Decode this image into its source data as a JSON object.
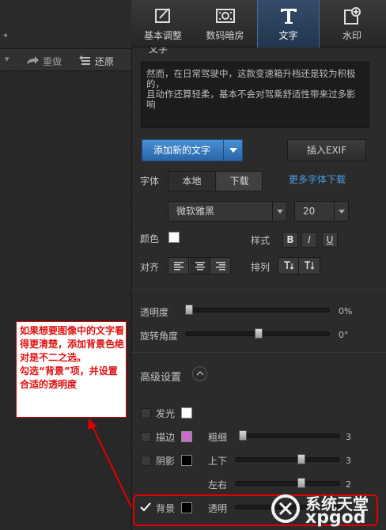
{
  "tabs": [
    {
      "label": "基本调整",
      "icon": "crop-icon"
    },
    {
      "label": "数码暗房",
      "icon": "film-icon"
    },
    {
      "label": "文字",
      "icon": "text-icon"
    },
    {
      "label": "水印",
      "icon": "watermark-icon"
    }
  ],
  "toolbar": {
    "redo": "重做",
    "restore": "还原"
  },
  "section_title": "文字",
  "text_content": "然而，在日常驾驶中，这款变速箱升档还是较为积极的，\n且动作还算轻柔，基本不会对驾乘舒适性带来过多影响",
  "add_text_button": "添加新的文字",
  "insert_exif_button": "插入EXIF",
  "font": {
    "label": "字体",
    "tab_local": "本地",
    "tab_download": "下载",
    "more_link": "更多字体下载",
    "family": "微软雅黑",
    "size": "20"
  },
  "color_label": "颜色",
  "style_label": "样式",
  "style_buttons": [
    "B",
    "I",
    "U"
  ],
  "align_label": "对齐",
  "arrange_label": "排列",
  "opacity": {
    "label": "透明度",
    "value": 0,
    "value_text": "0%"
  },
  "rotation": {
    "label": "旋转角度",
    "value": 0,
    "value_text": "0°"
  },
  "advanced_label": "高级设置",
  "glow": {
    "label": "发光",
    "checked": false,
    "color": "#ffffff"
  },
  "stroke": {
    "label": "描边",
    "checked": false,
    "color": "#c76fc7",
    "thickness_label": "粗细",
    "thickness_value": "3"
  },
  "shadow": {
    "label": "阴影",
    "checked": false,
    "color": "#000000",
    "vertical_label": "上下",
    "vertical_value": "3",
    "horizontal_label": "左右",
    "horizontal_value": "2"
  },
  "background": {
    "label": "背景",
    "checked": true,
    "color": "#000000",
    "transparency_label": "透明"
  },
  "annotation": {
    "text": "如果想要图像中的文字看得更清楚，添加背景色绝对是不二之选。\n勾选“背景”项，并设置合适的透明度",
    "color": "#e01010"
  },
  "watermark": {
    "line1": "系统天堂",
    "line2": "xpgod"
  }
}
